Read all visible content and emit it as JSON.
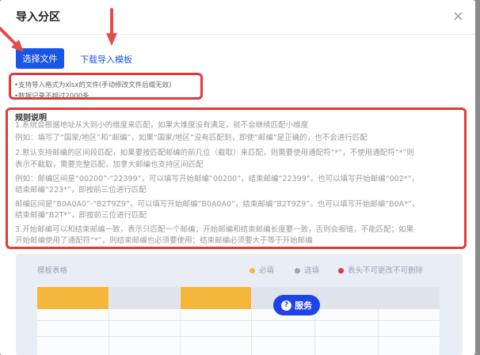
{
  "dialog": {
    "title": "导入分区",
    "close_label": "×"
  },
  "toolbar": {
    "select_file_label": "选择文件",
    "download_template_label": "下载导入模板"
  },
  "tips": [
    "•支持导入格式为xlsx的文件(手动修改文件后缀无效)",
    "•数据记录不超过2000条"
  ],
  "rules": {
    "title": "规则说明",
    "lines": [
      "1.系统会根据地址从大到小的维度来匹配，如果大维度没有满足，就不会继续匹配小维度",
      "例如：填写了“国家/地区”和“邮编”，如果“国家/地区”没有匹配到，即使“邮编”是正确的，也不会进行匹配",
      "2.默认支持邮编的区间段匹配，如果要按匹配邮编的前几位（截取）来匹配，则需要使用通配符“*”，不使用通配符“*”则",
      "表示不截取，需要完整匹配，加拿大邮编也支持区间匹配",
      "例如：邮编区间是“00200”-“22399”，可以填写开始邮编“00200”，结束邮编“22399”。也可以填写开始邮编“002*”，",
      "结束邮编“223*”，即按前三位进行匹配",
      "邮编区间是“B0A0A0”-“B2T9Z9”，可以填写开始邮编“B0A0A0”，结束邮编“B2T9Z9”。也可以填写开始邮编“B0A*”，",
      "结束邮编“B2T*”，即按前三位进行匹配",
      "3.开始邮编可以和结束邮编一致，表示只匹配一个邮编；开始邮编和结束邮编长度要一致，否则会报错，不能匹配；如果",
      "开始邮编使用了通配符“*”，则结束邮编也必须要使用；结束邮编必须要大于等于开始邮编"
    ]
  },
  "template": {
    "label": "模板表格",
    "legend": [
      {
        "label": "必填",
        "color": "#f5b73b"
      },
      {
        "label": "选填",
        "color": "#9aa4b5"
      },
      {
        "label": "表头不可更改不可删除",
        "color": "#e23a3a"
      }
    ],
    "header_colors": [
      "#f5b73b",
      "#dfe3ea",
      "#f5b73b",
      "#dfe3ea",
      "#dfe3ea",
      "#dfe3ea"
    ]
  },
  "service": {
    "label": "服务",
    "icon": "?"
  },
  "colors": {
    "primary": "#1a56e6",
    "annotation_red": "#e23a3a"
  }
}
